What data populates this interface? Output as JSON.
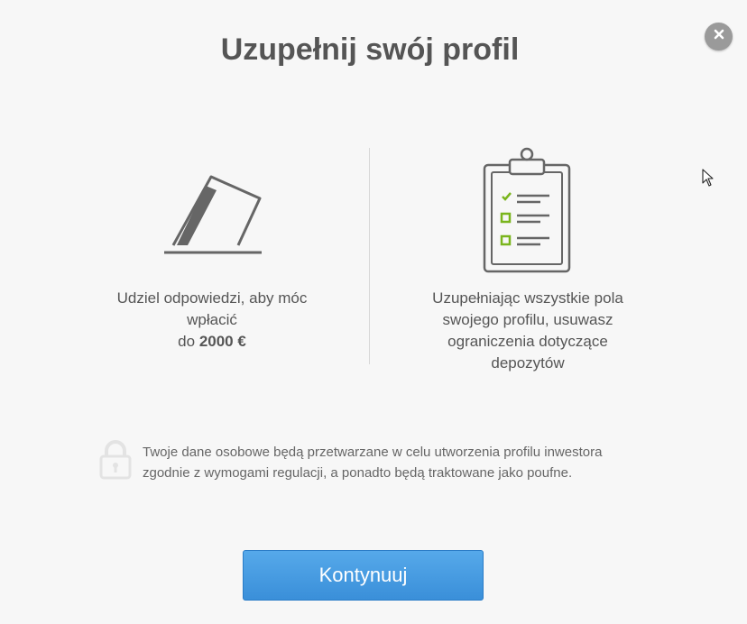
{
  "modal": {
    "title": "Uzupełnij swój profil",
    "close_label": "×"
  },
  "left": {
    "icon": "bank-card-slot-icon",
    "text_line1": "Udziel odpowiedzi, aby móc",
    "text_line2": "wpłacić",
    "text_prefix": "do ",
    "amount": "2000 €"
  },
  "right": {
    "icon": "checklist-clipboard-icon",
    "text_line1": "Uzupełniając wszystkie pola",
    "text_line2": "swojego profilu, usuwasz",
    "text_line3": "ograniczenia dotyczące",
    "text_line4": "depozytów"
  },
  "privacy": {
    "icon": "lock-icon",
    "text": "Twoje dane osobowe będą przetwarzane w celu utworzenia profilu inwestora zgodnie z wymogami regulacji, a ponadto będą traktowane jako poufne."
  },
  "actions": {
    "continue_label": "Kontynuuj"
  },
  "colors": {
    "accent_blue": "#3a8fd9",
    "check_green": "#7ab51d",
    "icon_gray": "#666666"
  }
}
